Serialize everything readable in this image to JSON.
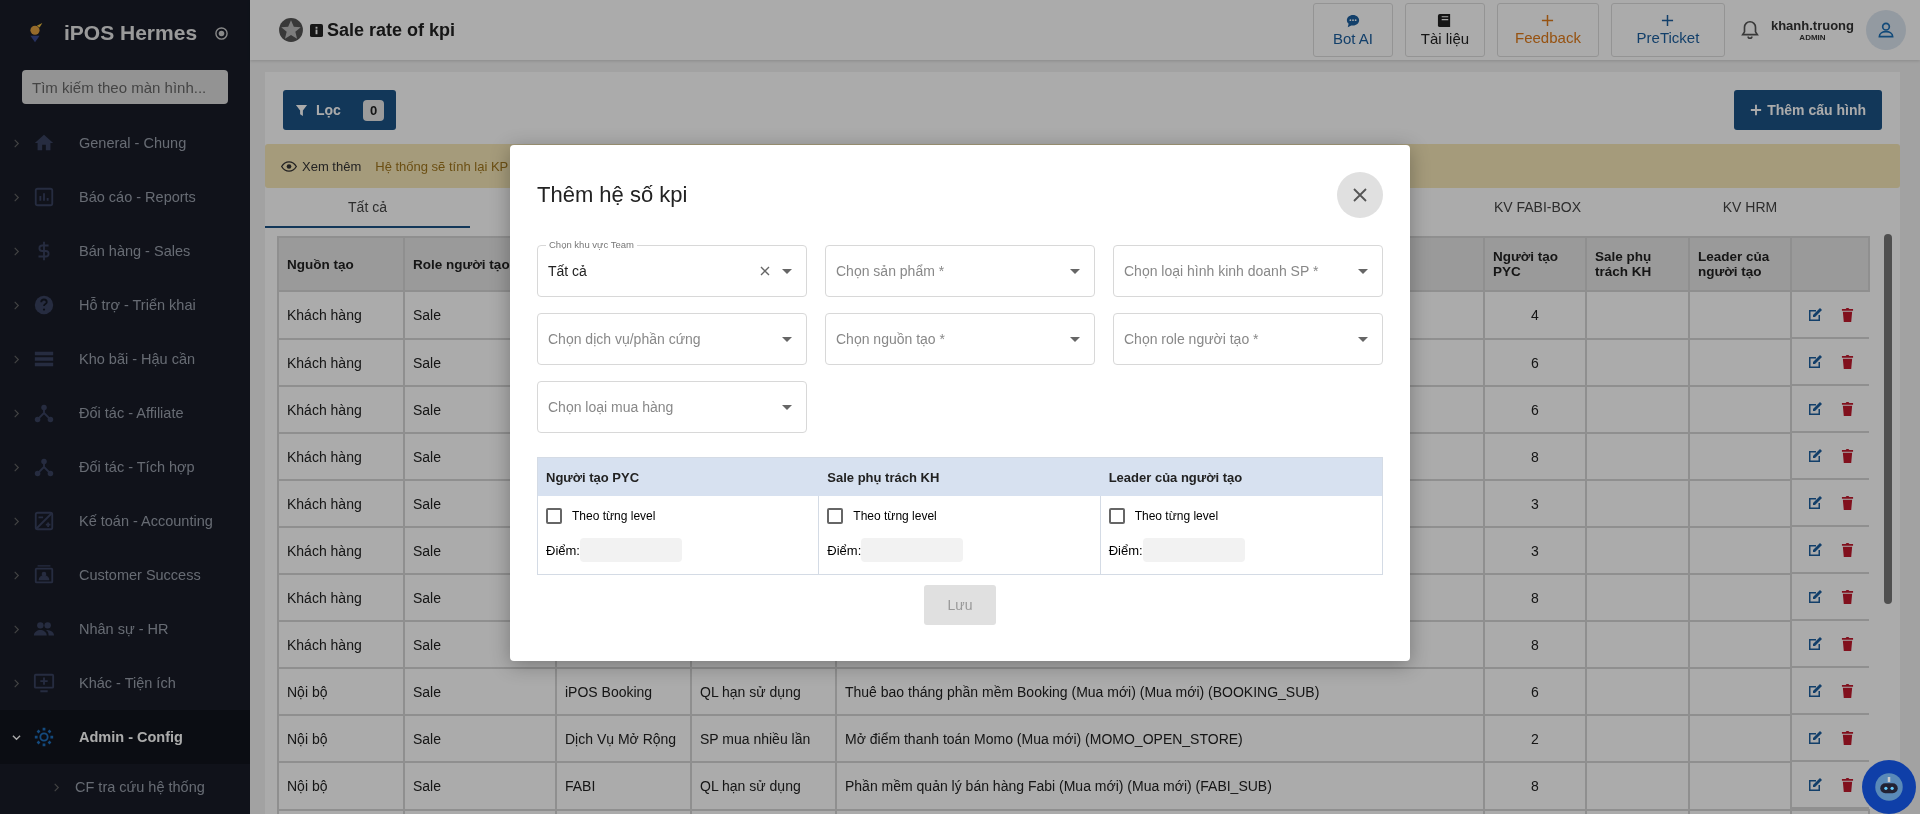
{
  "sidebar": {
    "app_name": "iPOS Hermes",
    "search": {
      "placeholder": "Tìm kiếm theo màn hình..."
    },
    "items": [
      {
        "label": "General - Chung",
        "selected": false,
        "expanded": false
      },
      {
        "label": "Báo cáo - Reports",
        "selected": false,
        "expanded": false
      },
      {
        "label": "Bán hàng - Sales",
        "selected": false,
        "expanded": false
      },
      {
        "label": "Hỗ trợ - Triển khai",
        "selected": false,
        "expanded": false
      },
      {
        "label": "Kho bãi - Hậu cần",
        "selected": false,
        "expanded": false
      },
      {
        "label": "Đối tác - Affiliate",
        "selected": false,
        "expanded": false
      },
      {
        "label": "Đối tác - Tích hợp",
        "selected": false,
        "expanded": false
      },
      {
        "label": "Kế toán - Accounting",
        "selected": false,
        "expanded": false
      },
      {
        "label": "Customer Success",
        "selected": false,
        "expanded": false
      },
      {
        "label": "Nhân sự - HR",
        "selected": false,
        "expanded": false
      },
      {
        "label": "Khác - Tiện ích",
        "selected": false,
        "expanded": false
      },
      {
        "label": "Admin - Config",
        "selected": true,
        "expanded": true,
        "children": [
          {
            "label": "CF tra cứu hệ thống"
          }
        ]
      }
    ]
  },
  "header": {
    "title": "Sale rate of kpi",
    "buttons": [
      {
        "label": "Bot AI",
        "kind": "chat"
      },
      {
        "label": "Tài liệu",
        "kind": "book"
      },
      {
        "label": "Feedback",
        "kind": "feedback"
      },
      {
        "label": "PreTicket",
        "kind": "ticket"
      }
    ],
    "user": {
      "name": "khanh.truong",
      "role": "ADMIN"
    }
  },
  "toolbar": {
    "filter": {
      "label": "Lọc",
      "count": "0"
    },
    "add_button": "Thêm cấu hình"
  },
  "banner": {
    "link": "Xem thêm",
    "text": "Hệ thống sẽ tính lại KP"
  },
  "tabs": [
    {
      "label": "Tất cả",
      "selected": true
    },
    {
      "label": "KV FABI-BOX",
      "selected": false
    },
    {
      "label": "KV HRM",
      "selected": false
    }
  ],
  "table": {
    "columns_left": [
      "Nguồn tạo",
      "Role người tạo"
    ],
    "columns_right": [
      "Người tạo PYC",
      "Sale phụ trách KH",
      "Leader của người tạo"
    ],
    "rows": [
      {
        "nguon_tao": "Khách hàng",
        "role": "Sale",
        "nguoi_tao_pyc": "4"
      },
      {
        "nguon_tao": "Khách hàng",
        "role": "Sale",
        "nguoi_tao_pyc": "6"
      },
      {
        "nguon_tao": "Khách hàng",
        "role": "Sale",
        "nguoi_tao_pyc": "6"
      },
      {
        "nguon_tao": "Khách hàng",
        "role": "Sale",
        "nguoi_tao_pyc": "8"
      },
      {
        "nguon_tao": "Khách hàng",
        "role": "Sale",
        "nguoi_tao_pyc": "3"
      },
      {
        "nguon_tao": "Khách hàng",
        "role": "Sale",
        "nguoi_tao_pyc": "3"
      },
      {
        "nguon_tao": "Khách hàng",
        "role": "Sale",
        "nguoi_tao_pyc": "8"
      },
      {
        "nguon_tao": "Khách hàng",
        "role": "Sale",
        "nguoi_tao_pyc": "8"
      },
      {
        "nguon_tao": "Nội bộ",
        "role": "Sale",
        "column_3": "iPOS Booking",
        "column_4": "QL hạn sử dụng",
        "column_5": "Thuê bao tháng phần mềm Booking (Mua mới) (Mua mới) (BOOKING_SUB)",
        "nguoi_tao_pyc": "6"
      },
      {
        "nguon_tao": "Nội bộ",
        "role": "Sale",
        "column_3": "Dịch Vụ Mở Rộng",
        "column_4": "SP mua nhiều lần",
        "column_5": "Mở điểm thanh toán Momo (Mua mới) (MOMO_OPEN_STORE)",
        "nguoi_tao_pyc": "2"
      },
      {
        "nguon_tao": "Nội bộ",
        "role": "Sale",
        "column_3": "FABI",
        "column_4": "QL hạn sử dụng",
        "column_5": "Phần mềm quản lý bán hàng Fabi (Mua mới) (Mua mới) (FABI_SUB)",
        "nguoi_tao_pyc": "8"
      }
    ]
  },
  "modal": {
    "title": "Thêm hệ số kpi",
    "fields": [
      {
        "label": "Chọn khu vực Team",
        "value": "Tất cả"
      },
      {
        "placeholder": "Chọn sản phẩm *"
      },
      {
        "placeholder": "Chọn loại hình kinh doanh SP *"
      },
      {
        "placeholder": "Chọn dịch vụ/phần cứng"
      },
      {
        "placeholder": "Chọn nguồn tạo *"
      },
      {
        "placeholder": "Chọn role người tạo *"
      },
      {
        "placeholder": "Chọn loại mua hàng"
      }
    ],
    "roles": [
      {
        "title": "Người tạo PYC",
        "checkbox": {
          "label": "Theo từng level",
          "checked": false
        },
        "score_label": "Điểm:"
      },
      {
        "title": "Sale phụ trách KH",
        "checkbox": {
          "label": "Theo từng level",
          "checked": false
        },
        "score_label": "Điểm:"
      },
      {
        "title": "Leader của người tạo",
        "checkbox": {
          "label": "Theo từng level",
          "checked": false
        },
        "score_label": "Điểm:"
      }
    ],
    "save_button": {
      "label": "Lưu",
      "disabled": true
    }
  }
}
